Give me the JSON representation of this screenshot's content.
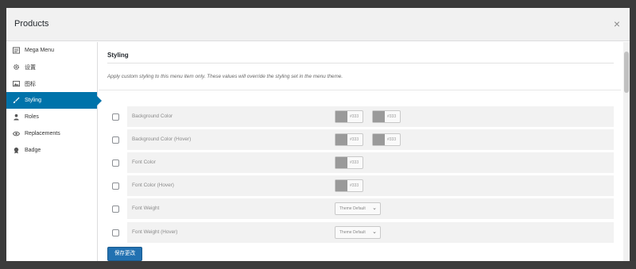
{
  "modal": {
    "title": "Products",
    "close_label": "×"
  },
  "sidebar": {
    "items": [
      {
        "label": "Mega Menu",
        "icon": "menu-grid-icon",
        "active": false
      },
      {
        "label": "设置",
        "icon": "gear-icon",
        "active": false
      },
      {
        "label": "图标",
        "icon": "image-icon",
        "active": false
      },
      {
        "label": "Styling",
        "icon": "brush-icon",
        "active": true
      },
      {
        "label": "Roles",
        "icon": "users-icon",
        "active": false
      },
      {
        "label": "Replacements",
        "icon": "visibility-icon",
        "active": false
      },
      {
        "label": "Badge",
        "icon": "badge-icon",
        "active": false
      }
    ]
  },
  "main": {
    "section_title": "Styling",
    "description": "Apply custom styling to this menu item only. These values will override the styling set in the menu theme.",
    "rows": [
      {
        "label": "Background Color",
        "swatches": [
          "#333",
          "#333"
        ]
      },
      {
        "label": "Background Color (Hover)",
        "swatches": [
          "#333",
          "#333"
        ]
      },
      {
        "label": "Font Color",
        "swatches": [
          "#333"
        ]
      },
      {
        "label": "Font Color (Hover)",
        "swatches": [
          "#333"
        ]
      },
      {
        "label": "Font Weight",
        "select": "Theme Default"
      },
      {
        "label": "Font Weight (Hover)",
        "select": "Theme Default"
      }
    ],
    "save_label": "保存更改"
  },
  "colors": {
    "accent": "#0073aa",
    "button": "#2271b1",
    "swatch": "#9a9a9a"
  }
}
